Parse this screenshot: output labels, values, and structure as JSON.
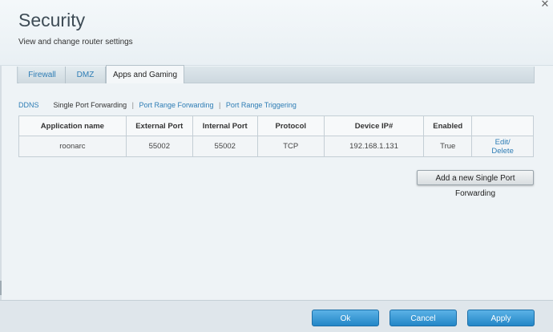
{
  "header": {
    "title": "Security",
    "subtitle": "View and change router settings",
    "close_glyph": "✕"
  },
  "tabs": [
    {
      "label": "Firewall",
      "active": false
    },
    {
      "label": "DMZ",
      "active": false
    },
    {
      "label": "Apps and Gaming",
      "active": true
    }
  ],
  "subnav": {
    "ddns": "DDNS",
    "single_port": "Single Port Forwarding",
    "sep": "|",
    "port_range": "Port Range Forwarding",
    "port_trigger": "Port Range Triggering"
  },
  "table": {
    "headers": [
      "Application name",
      "External Port",
      "Internal Port",
      "Protocol",
      "Device IP#",
      "Enabled",
      ""
    ],
    "rows": [
      {
        "app": "roonarc",
        "external_port": "55002",
        "internal_port": "55002",
        "protocol": "TCP",
        "device_ip": "192.168.1.131",
        "enabled": "True",
        "edit": "Edit/",
        "delete": "Delete"
      }
    ]
  },
  "add_button": "Add a new Single Port Forwarding",
  "footer": {
    "ok": "Ok",
    "cancel": "Cancel",
    "apply": "Apply"
  },
  "colors": {
    "link": "#2e7db5",
    "button_blue": "#2386c7",
    "title": "#3e4c56"
  }
}
